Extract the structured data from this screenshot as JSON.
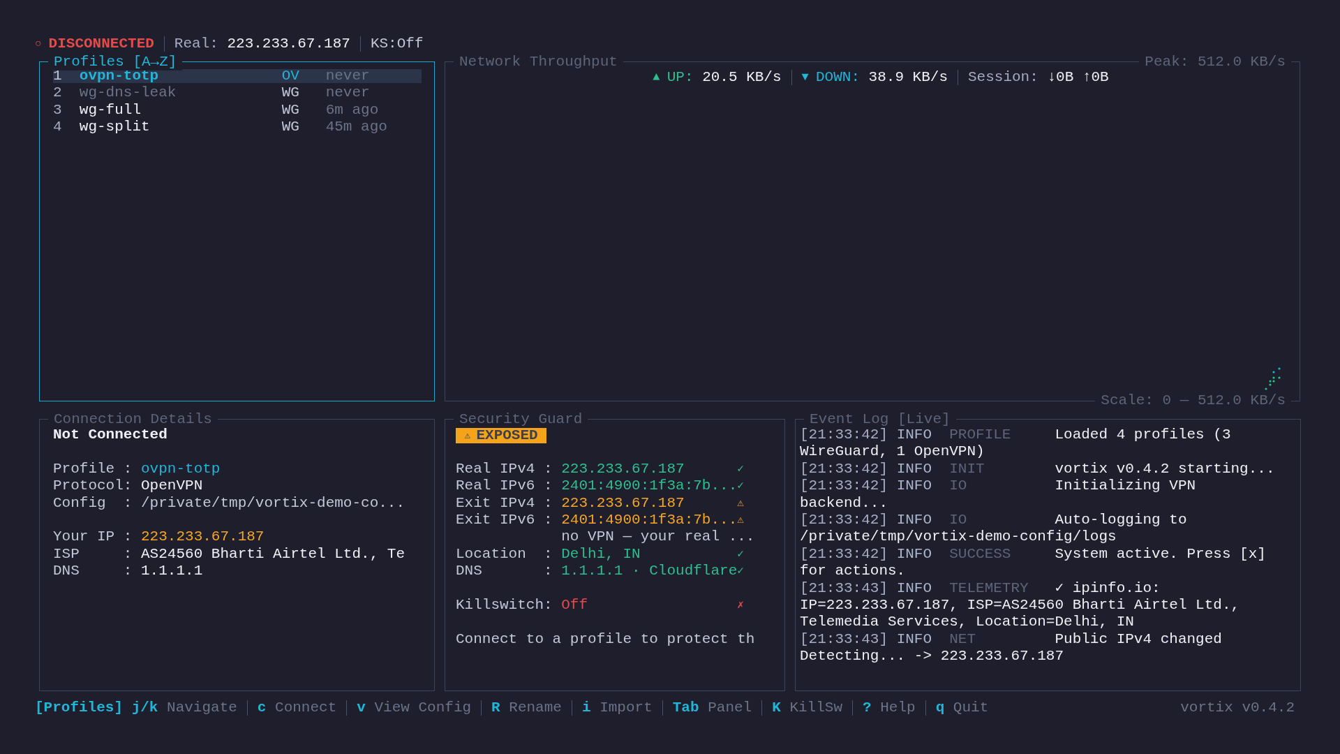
{
  "header": {
    "indicator": "○",
    "connected": false,
    "state": "DISCONNECTED",
    "real_label": "Real:",
    "real_ip": "223.233.67.187",
    "killswitch": "KS:Off"
  },
  "profiles": {
    "title": "Profiles [A→Z]",
    "items": [
      {
        "index": "1",
        "name": "ovpn-totp",
        "protocol": "OV",
        "last_used": "never",
        "selected": true,
        "dimmed": false
      },
      {
        "index": "2",
        "name": "wg-dns-leak",
        "protocol": "WG",
        "last_used": "never",
        "selected": false,
        "dimmed": true
      },
      {
        "index": "3",
        "name": "wg-full",
        "protocol": "WG",
        "last_used": "6m ago",
        "selected": false,
        "dimmed": false
      },
      {
        "index": "4",
        "name": "wg-split",
        "protocol": "WG",
        "last_used": "45m ago",
        "selected": false,
        "dimmed": false
      }
    ]
  },
  "throughput": {
    "title": "Network Throughput",
    "peak": "Peak: 512.0 KB/s",
    "up_arrow": "▲",
    "up_label": "UP:",
    "up_value": "20.5 KB/s",
    "down_arrow": "▼",
    "down_label": "DOWN:",
    "down_value": "38.9 KB/s",
    "session_label": "Session:",
    "session_down": "↓0B",
    "session_up": "↑0B",
    "scale": "Scale: 0 — 512.0 KB/s"
  },
  "connection_details": {
    "title": "Connection Details",
    "status": "Not Connected",
    "groups": [
      [
        {
          "label": "Profile :",
          "value": "ovpn-totp",
          "kind": "accent"
        },
        {
          "label": "Protocol:",
          "value": "OpenVPN",
          "kind": "plain"
        },
        {
          "label": "Config  :",
          "value": "/private/tmp/vortix-demo-co...",
          "kind": "muted"
        }
      ],
      [
        {
          "label": "Your IP :",
          "value": "223.233.67.187",
          "kind": "warning"
        },
        {
          "label": "ISP     :",
          "value": "AS24560 Bharti Airtel Ltd., Te",
          "kind": "plain"
        },
        {
          "label": "DNS     :",
          "value": "1.1.1.1",
          "kind": "plain"
        }
      ]
    ]
  },
  "security_guard": {
    "title": "Security Guard",
    "badge": {
      "icon": "⚠",
      "text": "EXPOSED"
    },
    "groups": [
      [
        {
          "kind": "ok",
          "label": "Real IPv4 :",
          "value": "223.233.67.187",
          "mark": "✓"
        },
        {
          "kind": "ok",
          "label": "Real IPv6 :",
          "value": "2401:4900:1f3a:7b...",
          "mark": "✓"
        },
        {
          "kind": "warning",
          "label": "Exit IPv4 :",
          "value": "223.233.67.187",
          "mark": "⚠"
        },
        {
          "kind": "warning",
          "label": "Exit IPv6 :",
          "value": "2401:4900:1f3a:7b...",
          "mark": "⚠"
        },
        {
          "kind": "note",
          "value": "no VPN — your real ..."
        },
        {
          "kind": "ok",
          "label": "Location  :",
          "value": "Delhi, IN",
          "mark": "✓"
        },
        {
          "kind": "ok",
          "label": "DNS       :",
          "value": "1.1.1.1 · Cloudflare",
          "mark": "✓"
        }
      ],
      [
        {
          "kind": "bad",
          "label": "Killswitch:",
          "value": "Off",
          "mark": "✗"
        }
      ]
    ],
    "message": "Connect to a profile to protect th"
  },
  "event_log": {
    "title": "Event Log [Live]",
    "entries": [
      {
        "time": "[21:33:42]",
        "level": "INFO",
        "source": "PROFILE",
        "message": "Loaded 4 profiles (3 WireGuard, 1 OpenVPN)"
      },
      {
        "time": "[21:33:42]",
        "level": "INFO",
        "source": "INIT",
        "message": "vortix v0.4.2 starting..."
      },
      {
        "time": "[21:33:42]",
        "level": "INFO",
        "source": "IO",
        "message": "Initializing VPN backend..."
      },
      {
        "time": "[21:33:42]",
        "level": "INFO",
        "source": "IO",
        "message": "Auto-logging to /private/tmp/vortix-demo-config/logs"
      },
      {
        "time": "[21:33:42]",
        "level": "INFO",
        "source": "SUCCESS",
        "message": "System active. Press [x] for actions."
      },
      {
        "time": "[21:33:43]",
        "level": "INFO",
        "source": "TELEMETRY",
        "message": "✓ ipinfo.io: IP=223.233.67.187, ISP=AS24560 Bharti Airtel Ltd., Telemedia Services, Location=Delhi, IN"
      },
      {
        "time": "[21:33:43]",
        "level": "INFO",
        "source": "NET",
        "message": "Public IPv4 changed Detecting... -> 223.233.67.187"
      }
    ]
  },
  "footer": {
    "context": "[Profiles]",
    "hints": [
      {
        "key": "j/k",
        "label": "Navigate"
      },
      {
        "key": "c",
        "label": "Connect"
      },
      {
        "key": "v",
        "label": "View Config"
      },
      {
        "key": "R",
        "label": "Rename"
      },
      {
        "key": "i",
        "label": "Import"
      },
      {
        "key": "Tab",
        "label": "Panel"
      },
      {
        "key": "K",
        "label": "KillSw"
      },
      {
        "key": "?",
        "label": "Help"
      },
      {
        "key": "q",
        "label": "Quit"
      }
    ],
    "version": "vortix v0.4.2"
  }
}
